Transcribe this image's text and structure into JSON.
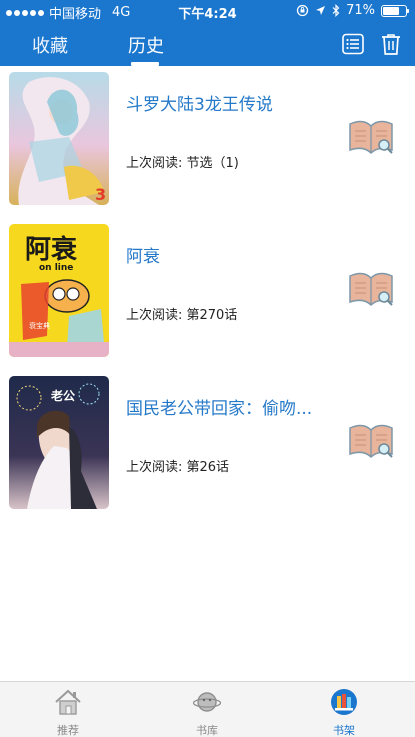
{
  "status_bar": {
    "carrier": "中国移动",
    "network": "4G",
    "time": "下午4:24",
    "battery_percent": "71%",
    "battery_level": 0.71
  },
  "header": {
    "tabs": [
      {
        "label": "收藏",
        "selected": false
      },
      {
        "label": "历史",
        "selected": true
      }
    ],
    "icons": [
      "list-icon",
      "trash-icon"
    ],
    "accent_color": "#1b76cd"
  },
  "history": [
    {
      "title": "斗罗大陆3龙王传说",
      "last_read": "上次阅读: 节选（1)"
    },
    {
      "title": "阿衰",
      "last_read": "上次阅读: 第270话"
    },
    {
      "title": "国民老公带回家：偷吻...",
      "last_read": "上次阅读: 第26话"
    }
  ],
  "tabbar": {
    "items": [
      {
        "label": "推荐",
        "icon": "house-icon",
        "active": false
      },
      {
        "label": "书库",
        "icon": "planet-icon",
        "active": false
      },
      {
        "label": "书架",
        "icon": "bookshelf-icon",
        "active": true
      }
    ]
  }
}
